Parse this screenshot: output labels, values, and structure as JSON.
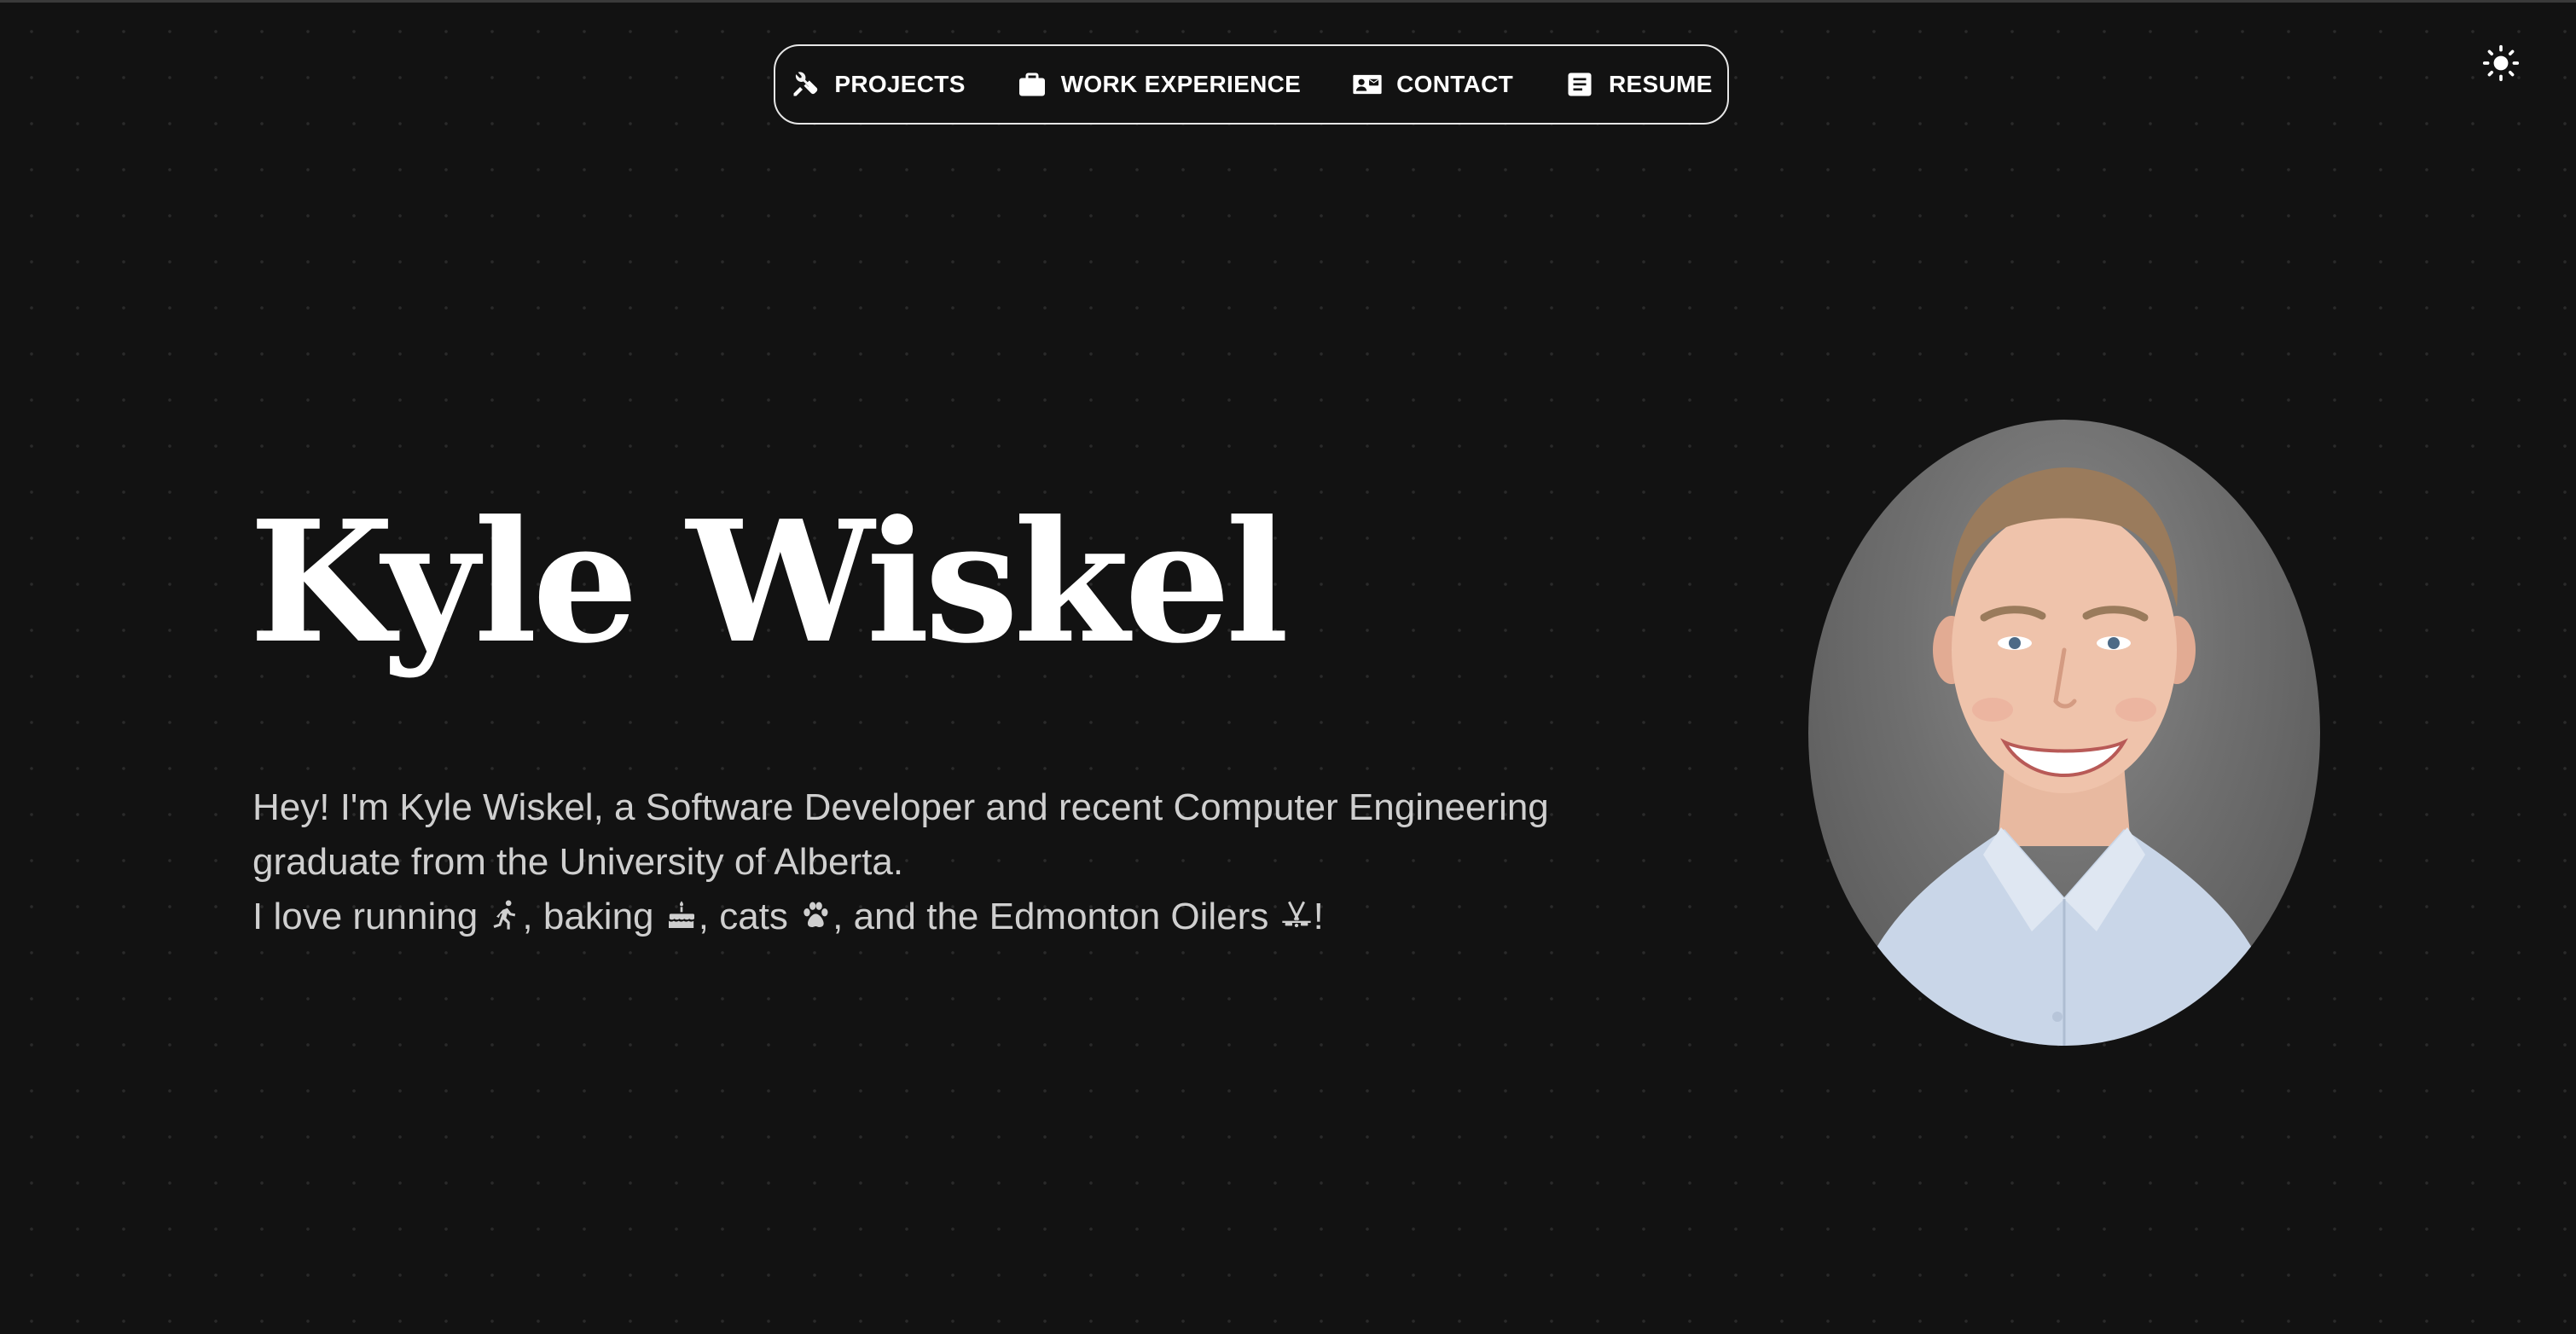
{
  "nav": {
    "items": [
      {
        "label": "PROJECTS",
        "icon": "tools-icon"
      },
      {
        "label": "WORK EXPERIENCE",
        "icon": "briefcase-icon"
      },
      {
        "label": "CONTACT",
        "icon": "contact-card-icon"
      },
      {
        "label": "RESUME",
        "icon": "document-icon"
      }
    ]
  },
  "theme_toggle": {
    "icon": "sun-icon"
  },
  "hero": {
    "name": "Kyle Wiskel",
    "intro_line1": "Hey! I'm Kyle Wiskel, a Software Developer and recent Computer Engineering",
    "intro_line2": "graduate from the University of Alberta.",
    "intro_line3_part1": "I love running",
    "intro_line3_part2": ", baking",
    "intro_line3_part3": ", cats",
    "intro_line3_part4": ", and the Edmonton Oilers",
    "intro_line3_part5": "!"
  },
  "colors": {
    "background": "#121212",
    "text": "#ffffff",
    "muted_text": "#cfcfcf",
    "nav_border": "#e6e6e6",
    "shirt": "#c9d6e8"
  }
}
